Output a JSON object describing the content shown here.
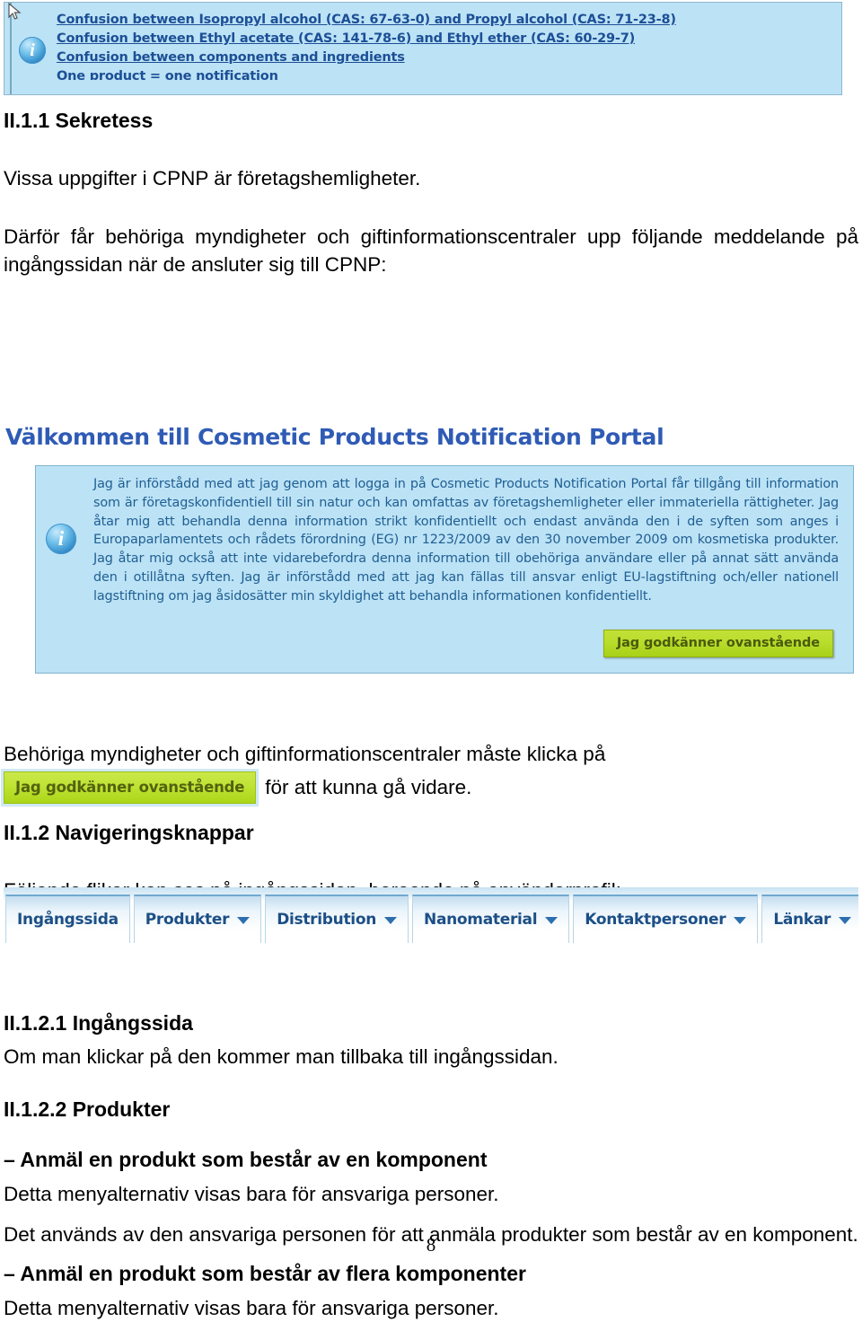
{
  "top_banner": {
    "icon": "info-icon",
    "lines": [
      "Confusion between Isopropyl alcohol (CAS: 67-63-0) and Propyl alcohol (CAS: 71-23-8)",
      "Confusion between Ethyl acetate (CAS: 141-78-6) and Ethyl ether (CAS: 60-29-7)",
      "Confusion between components and ingredients",
      "One product = one notification"
    ],
    "cursor": "mouse-pointer-icon",
    "background_color": "#bce2f5",
    "link_color": "#1c4f96"
  },
  "document": {
    "section_1": {
      "heading": "II.1.1 Sekretess",
      "paragraph_1": "Vissa uppgifter i CPNP är företagshemligheter.",
      "paragraph_2": "Därför får behöriga myndigheter och giftinformationscentraler upp följande meddelande på ingångssidan när de ansluter sig till CPNP:"
    },
    "after_welcome": {
      "line_1": "Behöriga myndigheter och giftinformationscentraler måste klicka på",
      "line_2_tail": "för att kunna gå vidare."
    },
    "section_2": {
      "heading": "II.1.2 Navigeringsknappar",
      "paragraph_1": "Följande flikar kan ses på ingångssidan, beroende på användarprofil:"
    },
    "section_2_1": {
      "heading": "II.1.2.1 Ingångssida",
      "paragraph_1": "Om man klickar på den kommer man tillbaka till ingångssidan."
    },
    "section_2_2": {
      "heading": "II.1.2.2 Produkter",
      "sub_1_heading": "– Anmäl en produkt som består av en komponent",
      "sub_1_paragraph_1": "Detta menyalternativ visas bara för ansvariga personer.",
      "sub_1_paragraph_2": "Det används av den ansvariga personen för att anmäla produkter som består av en komponent.",
      "sub_2_heading": "– Anmäl en produkt som består av flera komponenter",
      "sub_2_paragraph_1": "Detta menyalternativ visas bara för ansvariga personer."
    },
    "page_number": "8"
  },
  "welcome_screenshot": {
    "title": "Välkommen till Cosmetic Products Notification Portal",
    "icon": "info-icon",
    "consent_text": "Jag är införstådd med att jag genom att logga in på Cosmetic Products Notification Portal får tillgång till information som är företagskonfidentiell till sin natur och kan omfattas av företagshemligheter eller immateriella rättigheter. Jag åtar mig att behandla denna information strikt konfidentiellt och endast använda den i de syften som anges i Europaparlamentets och rådets förordning (EG) nr 1223/2009 av den 30 november 2009 om kosmetiska produkter. Jag åtar mig också att inte vidarebefordra denna information till obehöriga användare eller på annat sätt använda den i otillåtna syften. Jag är införstådd med att jag kan fällas till ansvar enligt EU-lagstiftning och/eller nationell lagstiftning om jag åsidosätter min skyldighet att behandla informationen konfidentiellt.",
    "approve_button": "Jag godkänner ovanstående",
    "panel_background": "#bce2f5",
    "text_color": "#1f5f93",
    "button_color": "#b9dd2c"
  },
  "tabs_screenshot": {
    "tabs": [
      {
        "label": "Ingångssida",
        "has_dropdown": false
      },
      {
        "label": "Produkter",
        "has_dropdown": true
      },
      {
        "label": "Distribution",
        "has_dropdown": true
      },
      {
        "label": "Nanomaterial",
        "has_dropdown": true
      },
      {
        "label": "Kontaktpersoner",
        "has_dropdown": true
      },
      {
        "label": "Länkar",
        "has_dropdown": true
      }
    ],
    "tab_text_color": "#1c4f86"
  }
}
